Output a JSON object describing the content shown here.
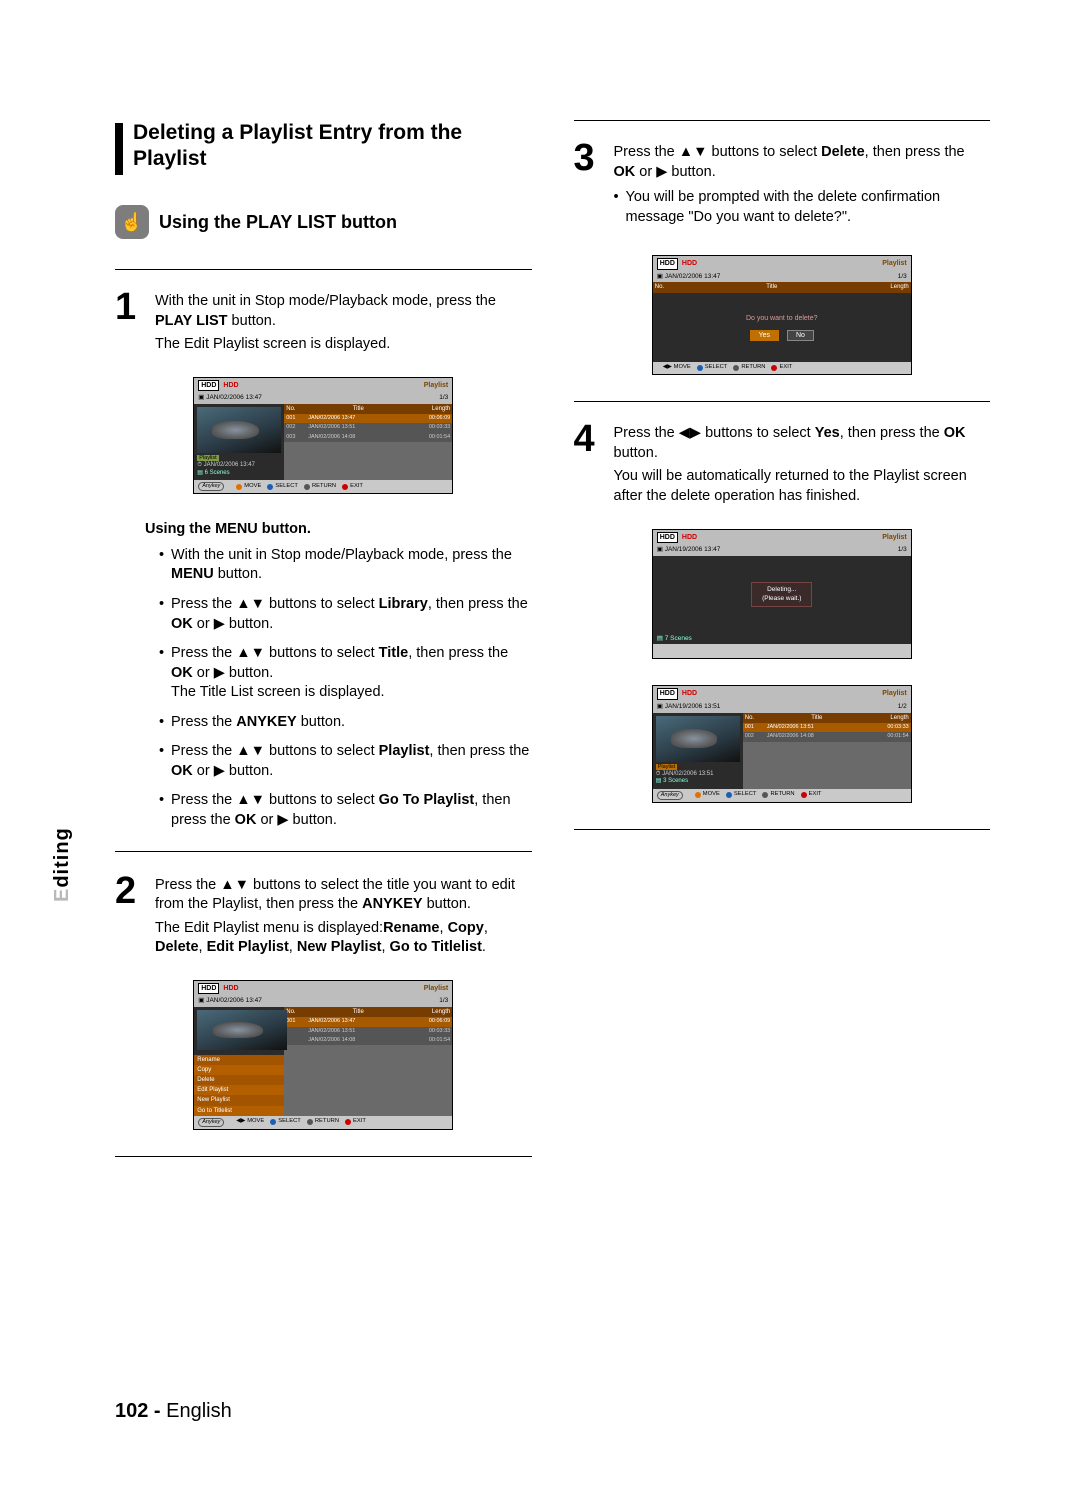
{
  "side_tab": "Editing",
  "section_title": "Deleting a Playlist Entry from the Playlist",
  "playlist_heading": "Using the PLAY LIST button",
  "menu_sub_heading": "Using the MENU button.",
  "arrows": {
    "ud": "▲▼",
    "lr": "◀▶",
    "play": "▶"
  },
  "steps": {
    "1": {
      "num": "1",
      "line1a": "With the unit in Stop mode/Playback mode, press the ",
      "line1b_bold": "PLAY LIST",
      "line1c": " button.",
      "line2": "The Edit Playlist screen is displayed."
    },
    "2": {
      "num": "2",
      "line1a": "Press the ",
      "line1b": " buttons to select the title you want to edit from the Playlist, then press the ",
      "line1c_bold": "ANYKEY",
      "line1d": " button.",
      "line2a": "The Edit Playlist menu is displayed:",
      "line2a_bold": "Rename",
      "line2b": ", ",
      "line2b_bold": "Copy",
      "line2c": ", ",
      "line2c_bold": "Delete",
      "line2d": ", ",
      "line2d_bold": "Edit Playlist",
      "line2e": ", ",
      "line2e_bold": "New Playlist",
      "line2f": ", ",
      "line2f_bold": "Go to Titlelist",
      "line2g": "."
    },
    "3": {
      "num": "3",
      "line1a": "Press the ",
      "line1b": " buttons to select ",
      "line1c_bold": "Delete",
      "line1d": ", then press the ",
      "line1e_bold": "OK",
      "line1f": " or ",
      "line1g": " button.",
      "bullet": "You will be prompted with the delete confirmation message \"Do you want to delete?\"."
    },
    "4": {
      "num": "4",
      "line1a": "Press the ",
      "line1b": " buttons to select ",
      "line1c_bold": "Yes",
      "line1d": ", then press the ",
      "line1e_bold": "OK",
      "line1f": " button.",
      "line2": "You will be automatically returned to the Playlist screen after the delete operation has finished."
    }
  },
  "menu_bullets": {
    "b1a": "With the unit in Stop mode/Playback mode, press the ",
    "b1b_bold": "MENU",
    "b1c": " button.",
    "b2a": "Press the ",
    "b2b": " buttons to select ",
    "b2c_bold": "Library",
    "b2d": ", then press the ",
    "b2e_bold": "OK",
    "b2f": " or ",
    "b2g": " button.",
    "b3a": "Press the ",
    "b3b": " buttons to select ",
    "b3c_bold": "Title",
    "b3d": ", then press the ",
    "b3e_bold": "OK",
    "b3f": " or ",
    "b3g": " button.",
    "b3h": "The Title List screen is displayed.",
    "b4a": "Press the ",
    "b4b_bold": "ANYKEY",
    "b4c": " button.",
    "b5a": "Press the ",
    "b5b": " buttons to select ",
    "b5c_bold": "Playlist",
    "b5d": ", then press the ",
    "b5e_bold": "OK",
    "b5f": " or ",
    "b5g": " button.",
    "b6a": "Press the ",
    "b6b": " buttons to select ",
    "b6c_bold": "Go To Playlist",
    "b6d": ", then press the ",
    "b6e_bold": "OK",
    "b6f": " or ",
    "b6g": " button."
  },
  "screens": {
    "common": {
      "hdd_box": "HDD",
      "hdd_label": "HDD",
      "playlist_label": "Playlist",
      "anykey": "Anykey",
      "move": "MOVE",
      "select": "SELECT",
      "return": "RETURN",
      "exit": "EXIT",
      "cols": {
        "no": "No.",
        "title": "Title",
        "length": "Length"
      }
    },
    "s1": {
      "date_top": "JAN/02/2006 13:47",
      "count": "1/3",
      "rows": [
        {
          "no": "001",
          "title": "JAN/02/2006 13:47",
          "len": "00:06:09"
        },
        {
          "no": "002",
          "title": "JAN/02/2006 13:51",
          "len": "00:03:33"
        },
        {
          "no": "003",
          "title": "JAN/02/2006 14:08",
          "len": "00:01:54"
        }
      ],
      "meta_pill": "Playlist",
      "meta_time": "JAN/02/2006 13:47",
      "meta_scenes": "6 Scenes"
    },
    "s2": {
      "date_top": "JAN/02/2006 13:47",
      "count": "1/3",
      "menu": [
        "Rename",
        "Copy",
        "Delete",
        "Edit Playlist",
        "New Playlist",
        "Go to Titlelist"
      ],
      "rows": [
        {
          "no": "001",
          "title": "JAN/02/2006 13:47",
          "len": "00:06:09"
        },
        {
          "no": "",
          "title": "JAN/02/2006 13:51",
          "len": "00:03:33"
        },
        {
          "no": "",
          "title": "JAN/02/2006 14:08",
          "len": "00:01:54"
        }
      ]
    },
    "s3": {
      "date_top": "JAN/02/2006 13:47",
      "count": "1/3",
      "dialog_msg": "Do you want to delete?",
      "yes": "Yes",
      "no_btn": "No"
    },
    "s4": {
      "date_top": "JAN/19/2006 13:47",
      "count": "1/3",
      "deleting1": "Deleting...",
      "deleting2": "(Please wait.)",
      "meta_scenes": "7 Scenes"
    },
    "s5": {
      "date_top": "JAN/19/2006 13:51",
      "count": "1/2",
      "rows": [
        {
          "no": "001",
          "title": "JAN/02/2006 13:51",
          "len": "00:03:33"
        },
        {
          "no": "002",
          "title": "JAN/02/2006 14:08",
          "len": "00:01:54"
        }
      ],
      "meta_pill": "Playlist",
      "meta_time": "JAN/02/2006 13:51",
      "meta_scenes": "3 Scenes"
    }
  },
  "footer": {
    "page_num": "102 -",
    "lang": "English"
  }
}
